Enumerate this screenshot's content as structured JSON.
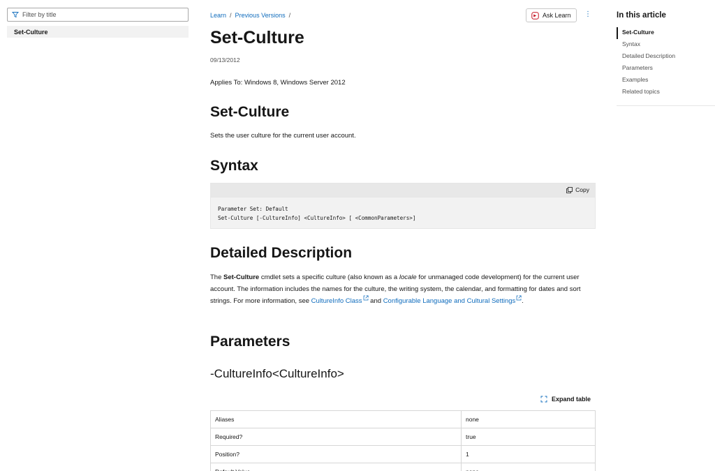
{
  "sidebar": {
    "filter_placeholder": "Filter by title",
    "items": [
      {
        "label": "Set-Culture"
      }
    ]
  },
  "breadcrumb": {
    "items": [
      {
        "label": "Learn"
      },
      {
        "label": "Previous Versions"
      }
    ],
    "separator": "/"
  },
  "header": {
    "ask_learn_label": "Ask Learn",
    "more_label": "⋮"
  },
  "article": {
    "title": "Set-Culture",
    "date": "09/13/2012",
    "applies_to": "Applies To: Windows 8, Windows Server 2012",
    "section_set_culture": {
      "heading": "Set-Culture",
      "text": "Sets the user culture for the current user account."
    },
    "syntax": {
      "heading": "Syntax",
      "copy_label": "Copy",
      "code_line1": "Parameter Set: Default",
      "code_line2": "Set-Culture [-CultureInfo] <CultureInfo> [ <CommonParameters>]"
    },
    "detailed": {
      "heading": "Detailed Description",
      "p1_a": "The ",
      "p1_bold": "Set-Culture",
      "p1_b": " cmdlet sets a specific culture (also known as a ",
      "p1_italic": "locale",
      "p1_c": " for unmanaged code development) for the current user account. The information includes the names for the culture, the writing system, the calendar, and formatting for dates and sort strings. For more information, see ",
      "link1": "CultureInfo Class",
      "p1_d": " and ",
      "link2": "Configurable Language and Cultural Settings",
      "p1_e": "."
    },
    "parameters": {
      "heading": "Parameters",
      "param_heading": "-CultureInfo<CultureInfo>",
      "expand_label": "Expand table",
      "rows": [
        {
          "name": "Aliases",
          "value": "none"
        },
        {
          "name": "Required?",
          "value": "true"
        },
        {
          "name": "Position?",
          "value": "1"
        },
        {
          "name": "Default Value",
          "value": "none"
        }
      ]
    }
  },
  "in_this_article": {
    "title": "In this article",
    "links": [
      {
        "label": "Set-Culture"
      },
      {
        "label": "Syntax"
      },
      {
        "label": "Detailed Description"
      },
      {
        "label": "Parameters"
      },
      {
        "label": "Examples"
      },
      {
        "label": "Related topics"
      }
    ]
  },
  "colors": {
    "link": "#0f6cbd",
    "text": "#161616",
    "muted": "#505050",
    "sidebar_selected_bg": "#f2f2f2",
    "code_bg": "#f2f2f2"
  }
}
